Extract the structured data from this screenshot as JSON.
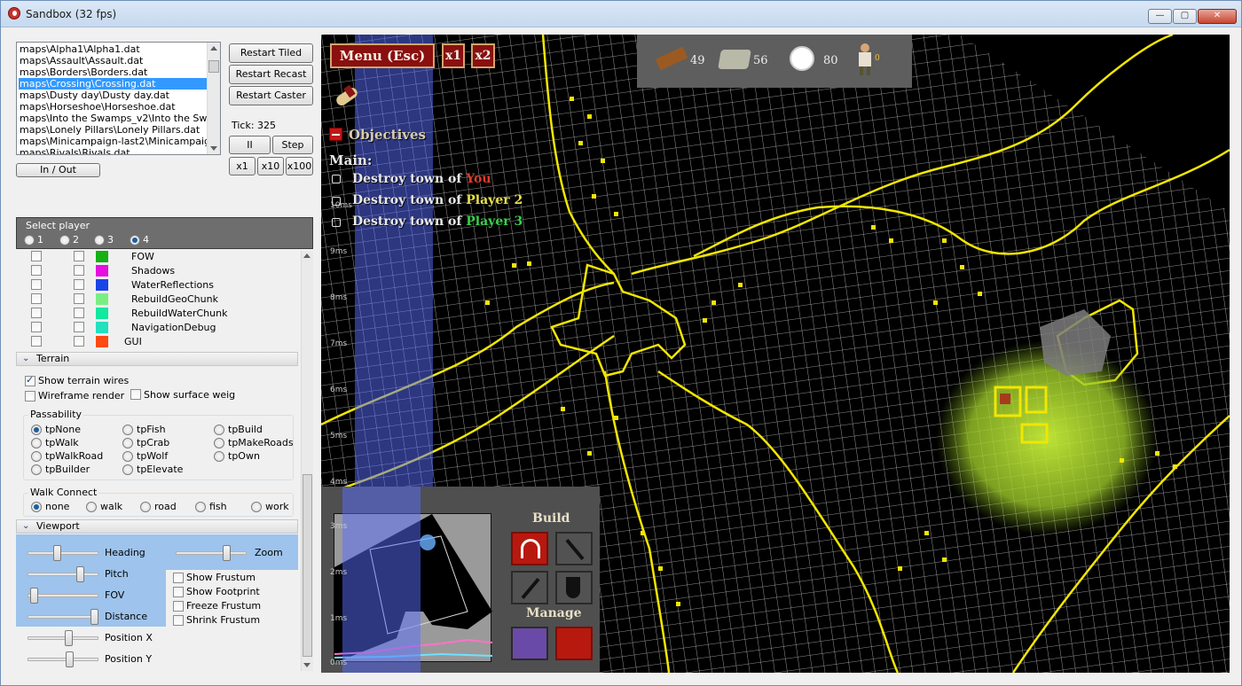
{
  "window": {
    "title": "Sandbox (32 fps)"
  },
  "maps": {
    "items": [
      "maps\\Alpha1\\Alpha1.dat",
      "maps\\Assault\\Assault.dat",
      "maps\\Borders\\Borders.dat",
      "maps\\Crossing\\Crossing.dat",
      "maps\\Dusty day\\Dusty day.dat",
      "maps\\Horseshoe\\Horseshoe.dat",
      "maps\\Into the Swamps_v2\\Into the Swamps",
      "maps\\Lonely Pillars\\Lonely Pillars.dat",
      "maps\\Minicampaign-last2\\Minicampaign-last",
      "maps\\Rivals\\Rivals.dat"
    ],
    "selected_index": 3
  },
  "controls": {
    "restart_tiled": "Restart Tiled",
    "restart_recast": "Restart Recast",
    "restart_caster": "Restart Caster",
    "tick": "Tick: 325",
    "pause": "II",
    "step": "Step",
    "x1": "x1",
    "x10": "x10",
    "x100": "x100",
    "in_out": "In / Out"
  },
  "player_select": {
    "caption": "Select player",
    "options": [
      "1",
      "2",
      "3",
      "4"
    ],
    "selected": "4"
  },
  "debug_layers": [
    {
      "label": "FOW",
      "color": "#14b014"
    },
    {
      "label": "Shadows",
      "color": "#e60fe0"
    },
    {
      "label": "WaterReflections",
      "color": "#1a45e6"
    },
    {
      "label": "RebuildGeoChunk",
      "color": "#7aee84"
    },
    {
      "label": "RebuildWaterChunk",
      "color": "#11e8a0"
    },
    {
      "label": "NavigationDebug",
      "color": "#23e0bf"
    },
    {
      "label": "GUI",
      "color": "#ff4a12"
    }
  ],
  "terrain": {
    "section": "Terrain",
    "show_terrain_wires": "Show terrain wires",
    "wireframe_render": "Wireframe render",
    "show_surface_weig": "Show surface weig",
    "passability_caption": "Passability",
    "passability": [
      "tpNone",
      "tpFish",
      "tpBuild",
      "tpWalk",
      "tpCrab",
      "tpMakeRoads",
      "tpWalkRoad",
      "tpWolf",
      "tpOwn",
      "tpBuilder",
      "tpElevate"
    ],
    "passability_selected": "tpNone",
    "walk_connect_caption": "Walk Connect",
    "walk_connect": [
      "none",
      "walk",
      "road",
      "fish",
      "work"
    ],
    "walk_connect_selected": "none"
  },
  "viewport": {
    "section": "Viewport",
    "heading": "Heading",
    "zoom": "Zoom",
    "pitch": "Pitch",
    "fov": "FOV",
    "distance": "Distance",
    "position_x": "Position X",
    "position_y": "Position Y",
    "show_frustum": "Show Frustum",
    "show_footprint": "Show Footprint",
    "freeze_frustum": "Freeze Frustum",
    "shrink_frustum": "Shrink Frustum"
  },
  "game": {
    "menu": "Menu (Esc)",
    "speed_x1": "x1",
    "speed_x2": "x2",
    "resources": [
      {
        "icon": "timber-icon",
        "value": "49"
      },
      {
        "icon": "stone-icon",
        "value": "56"
      },
      {
        "icon": "food-plate-icon",
        "value": "80"
      },
      {
        "icon": "worker-icon",
        "value": "0"
      }
    ],
    "objectives_title": "Objectives",
    "main_label": "Main:",
    "objectives": [
      {
        "text": "Destroy town of ",
        "target": "You",
        "target_color": "#e03a2a"
      },
      {
        "text": "Destroy town of ",
        "target": "Player 2",
        "target_color": "#e8e04a"
      },
      {
        "text": "Destroy town of ",
        "target": "Player 3",
        "target_color": "#3ad04a"
      }
    ],
    "perf_labels": [
      "10ms",
      "9ms",
      "8ms",
      "7ms",
      "6ms",
      "5ms",
      "4ms"
    ],
    "mini_perf_labels": [
      "3ms",
      "2ms",
      "1ms",
      "0ms"
    ],
    "build_title": "Build",
    "manage_title": "Manage",
    "colors": {
      "border_line": "#f2e600",
      "grid": "#ffffff",
      "town_glow": "#b6e03a"
    }
  }
}
